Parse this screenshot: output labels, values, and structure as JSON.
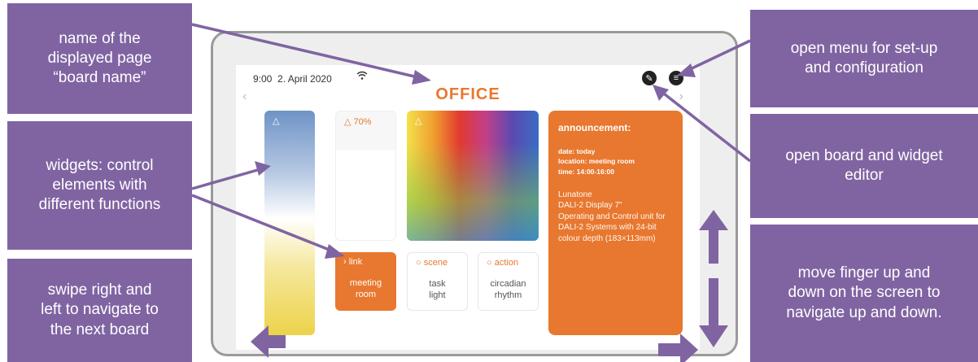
{
  "callouts": {
    "board_name": "name of the\ndisplayed page\n“board name”",
    "widgets": "widgets: control\nelements with\ndifferent functions",
    "swipe": "swipe right and\nleft to navigate to\nthe next board",
    "menu": "open menu for set-up\nand configuration",
    "editor": "open board and widget\neditor",
    "scroll": "move finger up and\ndown on the screen to\nnavigate up and down."
  },
  "screen": {
    "time": "9:00",
    "date": "2. April 2020",
    "board_title": "OFFICE",
    "nav_left": "‹",
    "nav_right": "›",
    "edit_icon": "✎",
    "menu_icon": "≡",
    "widgets": {
      "dimmer_label": "70%",
      "link": {
        "label": "link",
        "text": "meeting\nroom"
      },
      "scene": {
        "label": "scene",
        "text": "task\nlight"
      },
      "action": {
        "label": "action",
        "text": "circadian\nrhythm"
      },
      "announcement": {
        "title": "announcement:",
        "date": "date: today",
        "location": "location: meeting room",
        "time": "time: 14:00-16:00",
        "description": "Lunatone\nDALI-2 Display 7\"\nOperating and Control unit for DALI-2 Systems with 24-bit colour depth (183×113mm)"
      }
    }
  },
  "colors": {
    "callout_bg": "#8064a2",
    "accent": "#e8782f",
    "arrow": "#8064a2"
  }
}
